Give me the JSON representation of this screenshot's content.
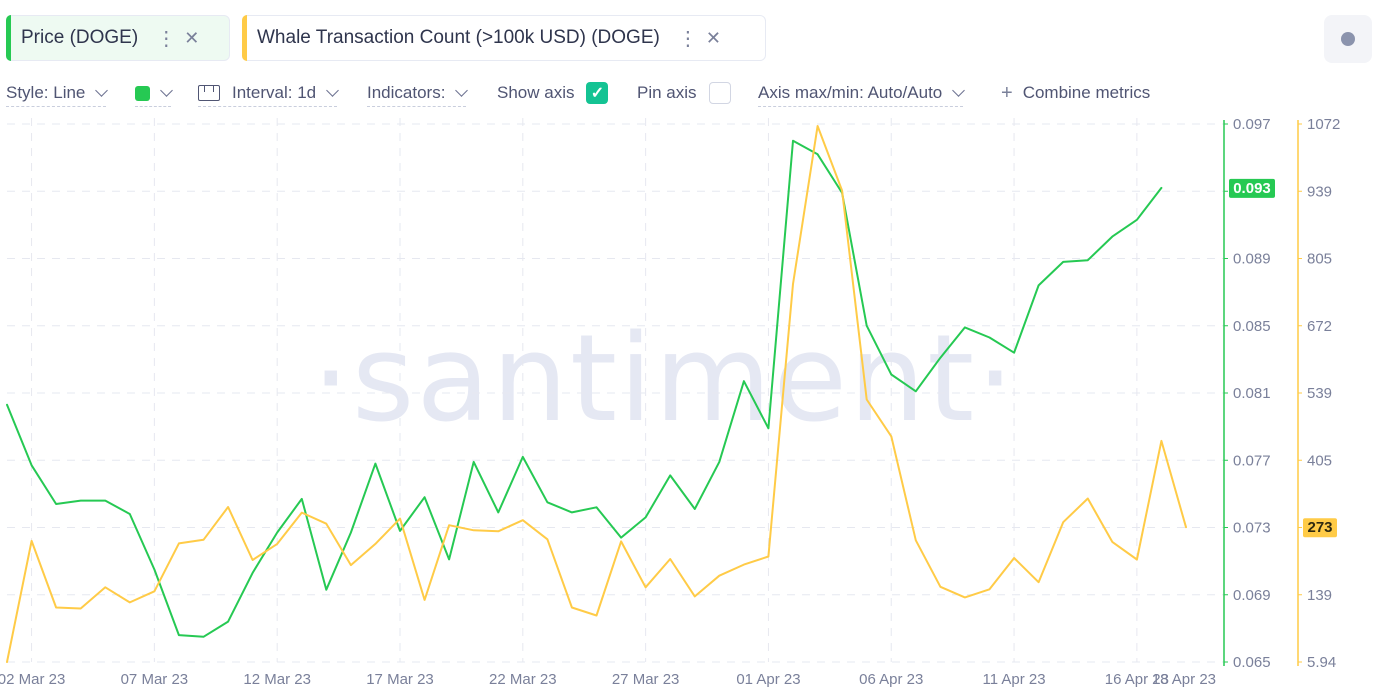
{
  "metrics": [
    {
      "label": "Price (DOGE)",
      "color": "#26c953",
      "more_icon": "more-vertical-icon",
      "close_icon": "close-icon"
    },
    {
      "label": "Whale Transaction Count (>100k USD) (DOGE)",
      "color": "#ffcb47",
      "more_icon": "more-vertical-icon",
      "close_icon": "close-icon"
    }
  ],
  "toolbar": {
    "style_label": "Style: Line",
    "interval_label": "Interval: 1d",
    "indicators_label": "Indicators:",
    "show_axis_label": "Show axis",
    "show_axis_checked": true,
    "pin_axis_label": "Pin axis",
    "pin_axis_checked": false,
    "axis_maxmin_label": "Axis max/min: Auto/Auto",
    "combine_label": "Combine metrics",
    "line_color": "#26c953"
  },
  "watermark": "·santiment·",
  "chart_data": {
    "type": "line",
    "grid": true,
    "x_tick_labels": [
      "02 Mar 23",
      "07 Mar 23",
      "12 Mar 23",
      "17 Mar 23",
      "22 Mar 23",
      "27 Mar 23",
      "01 Apr 23",
      "06 Apr 23",
      "11 Apr 23",
      "16 Apr 23",
      "18 Apr 23"
    ],
    "x_start": "2023-03-01",
    "x_end": "2023-04-18",
    "series": [
      {
        "name": "Price (DOGE)",
        "color": "#26c953",
        "axis": "left",
        "ylim": [
          0.065,
          0.097
        ],
        "y_ticks": [
          "0.097",
          "0.093",
          "0.089",
          "0.085",
          "0.081",
          "0.077",
          "0.073",
          "0.069",
          "0.065"
        ],
        "last_value_label": "0.093",
        "values": [
          0.0803,
          0.0767,
          0.0744,
          0.0746,
          0.0746,
          0.0738,
          0.0705,
          0.0666,
          0.0665,
          0.0674,
          0.0703,
          0.0727,
          0.0747,
          0.0693,
          0.0727,
          0.0768,
          0.0728,
          0.0748,
          0.0711,
          0.0769,
          0.0739,
          0.0772,
          0.0745,
          0.0739,
          0.0742,
          0.0724,
          0.0736,
          0.0761,
          0.0741,
          0.0769,
          0.0817,
          0.0789,
          0.096,
          0.0952,
          0.0929,
          0.085,
          0.0821,
          0.0811,
          0.0831,
          0.0849,
          0.0843,
          0.0834,
          0.0874,
          0.0888,
          0.0889,
          0.0903,
          0.0913,
          0.0932
        ]
      },
      {
        "name": "Whale Transaction Count (>100k USD) (DOGE)",
        "color": "#ffcb47",
        "axis": "right",
        "ylim": [
          5.94,
          1072
        ],
        "y_ticks": [
          "1072",
          "939",
          "805",
          "672",
          "539",
          "405",
          "273",
          "139",
          "5.94"
        ],
        "last_value_label": "273",
        "values": [
          6,
          246,
          114,
          112,
          154,
          124,
          146,
          241,
          248,
          313,
          208,
          240,
          302,
          280,
          198,
          240,
          290,
          129,
          277,
          267,
          265,
          287,
          249,
          114,
          98,
          245,
          154,
          210,
          136,
          177,
          199,
          215,
          755,
          1068,
          940,
          526,
          453,
          247,
          155,
          134,
          150,
          212,
          164,
          283,
          330,
          244,
          209,
          444,
          273
        ]
      }
    ]
  }
}
